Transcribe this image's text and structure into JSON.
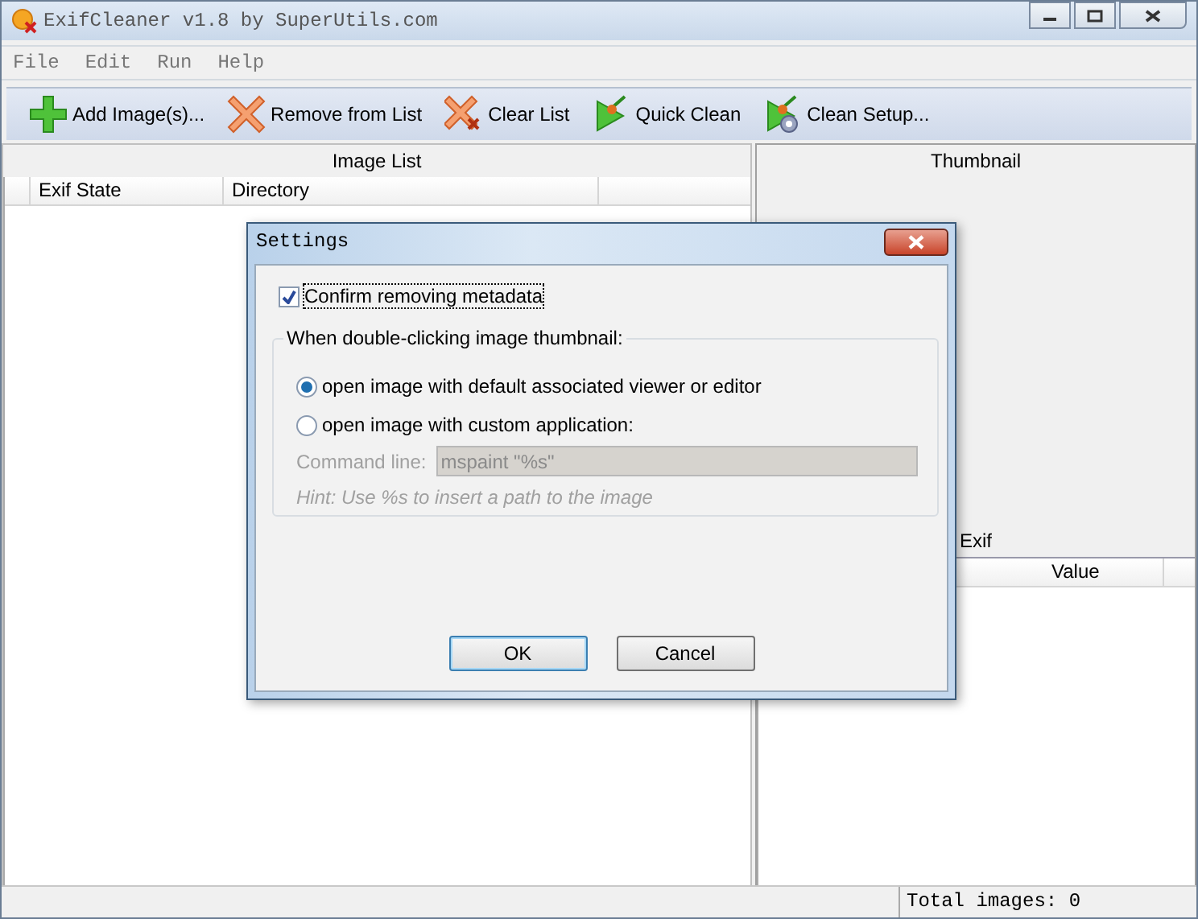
{
  "window": {
    "title": "ExifCleaner v1.8 by SuperUtils.com"
  },
  "menu": [
    {
      "label": "File"
    },
    {
      "label": "Edit"
    },
    {
      "label": "Run"
    },
    {
      "label": "Help"
    }
  ],
  "toolbar": [
    {
      "label": "Add Image(s)...",
      "kind": "add"
    },
    {
      "label": "Remove from List",
      "kind": "remove"
    },
    {
      "label": "Clear List",
      "kind": "clear"
    },
    {
      "label": "Quick Clean",
      "kind": "quick"
    },
    {
      "label": "Clean Setup...",
      "kind": "setup"
    }
  ],
  "image_list": {
    "title": "Image List",
    "columns": [
      "Exif State",
      "Directory"
    ]
  },
  "thumbnail": {
    "title": "Thumbnail"
  },
  "exif": {
    "title": "Exif",
    "columns": [
      "Value"
    ]
  },
  "status_bar": {
    "text": "Total images: 0"
  },
  "dialog": {
    "title": "Settings",
    "confirm": {
      "label": "Confirm removing metadata",
      "checked": true
    },
    "group": {
      "title": "When double-clicking image thumbnail:",
      "options": [
        {
          "label": "open image with default associated viewer or editor",
          "selected": true
        },
        {
          "label": "open image with custom application:",
          "selected": false
        }
      ],
      "command": {
        "label": "Command line:",
        "value": "mspaint \"%s\"",
        "disabled": true
      },
      "hint": "Hint: Use %s to insert a path to the image"
    },
    "buttons": [
      {
        "label": "OK",
        "default": true
      },
      {
        "label": "Cancel",
        "default": false
      }
    ]
  }
}
